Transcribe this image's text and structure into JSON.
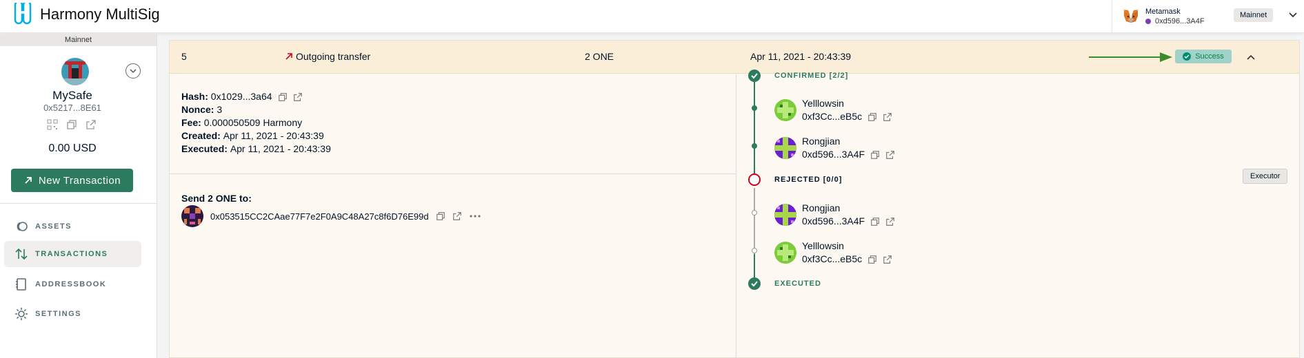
{
  "app": {
    "name": "Harmony MultiSig"
  },
  "wallet": {
    "provider": "Metamask",
    "address": "0xd596...3A4F",
    "network": "Mainnet"
  },
  "sidebar": {
    "network": "Mainnet",
    "safe_name": "MySafe",
    "safe_address": "0x5217...8E61",
    "balance": "0.00 USD",
    "new_tx_label": "New Transaction",
    "nav": [
      {
        "label": "ASSETS",
        "icon": "assets-icon"
      },
      {
        "label": "TRANSACTIONS",
        "icon": "transactions-icon",
        "active": true
      },
      {
        "label": "ADDRESSBOOK",
        "icon": "addressbook-icon"
      },
      {
        "label": "SETTINGS",
        "icon": "settings-icon"
      }
    ]
  },
  "tx": {
    "nonce_col": "5",
    "type": "Outgoing transfer",
    "amount": "2 ONE",
    "date": "Apr 11, 2021 - 20:43:39",
    "status": "Success",
    "details": {
      "hash_label": "Hash:",
      "hash": "0x1029...3a64",
      "nonce_label": "Nonce:",
      "nonce": "3",
      "fee_label": "Fee:",
      "fee": "0.000050509 Harmony",
      "created_label": "Created:",
      "created": "Apr 11, 2021 - 20:43:39",
      "executed_label": "Executed:",
      "executed": "Apr 11, 2021 - 20:43:39"
    },
    "send_label": "Send 2 ONE to:",
    "recipient": "0x053515CC2CAae77F7e2F0A9C48A27c8f6D76E99d"
  },
  "timeline": {
    "confirmed_label": "CONFIRMED [2/2]",
    "rejected_label": "REJECTED [0/0]",
    "executed_label": "EXECUTED",
    "executor_badge": "Executor",
    "confirmed": [
      {
        "name": "Yelllowsin",
        "address": "0xf3Cc...eB5c"
      },
      {
        "name": "Rongjian",
        "address": "0xd596...3A4F"
      }
    ],
    "rejected": [
      {
        "name": "Rongjian",
        "address": "0xd596...3A4F"
      },
      {
        "name": "Yelllowsin",
        "address": "0xf3Cc...eB5c"
      }
    ]
  },
  "colors": {
    "accent": "#2d7b5e",
    "header_bg": "#fbeed9",
    "success_bg": "#a1d2ca",
    "reject": "#d0021b"
  }
}
